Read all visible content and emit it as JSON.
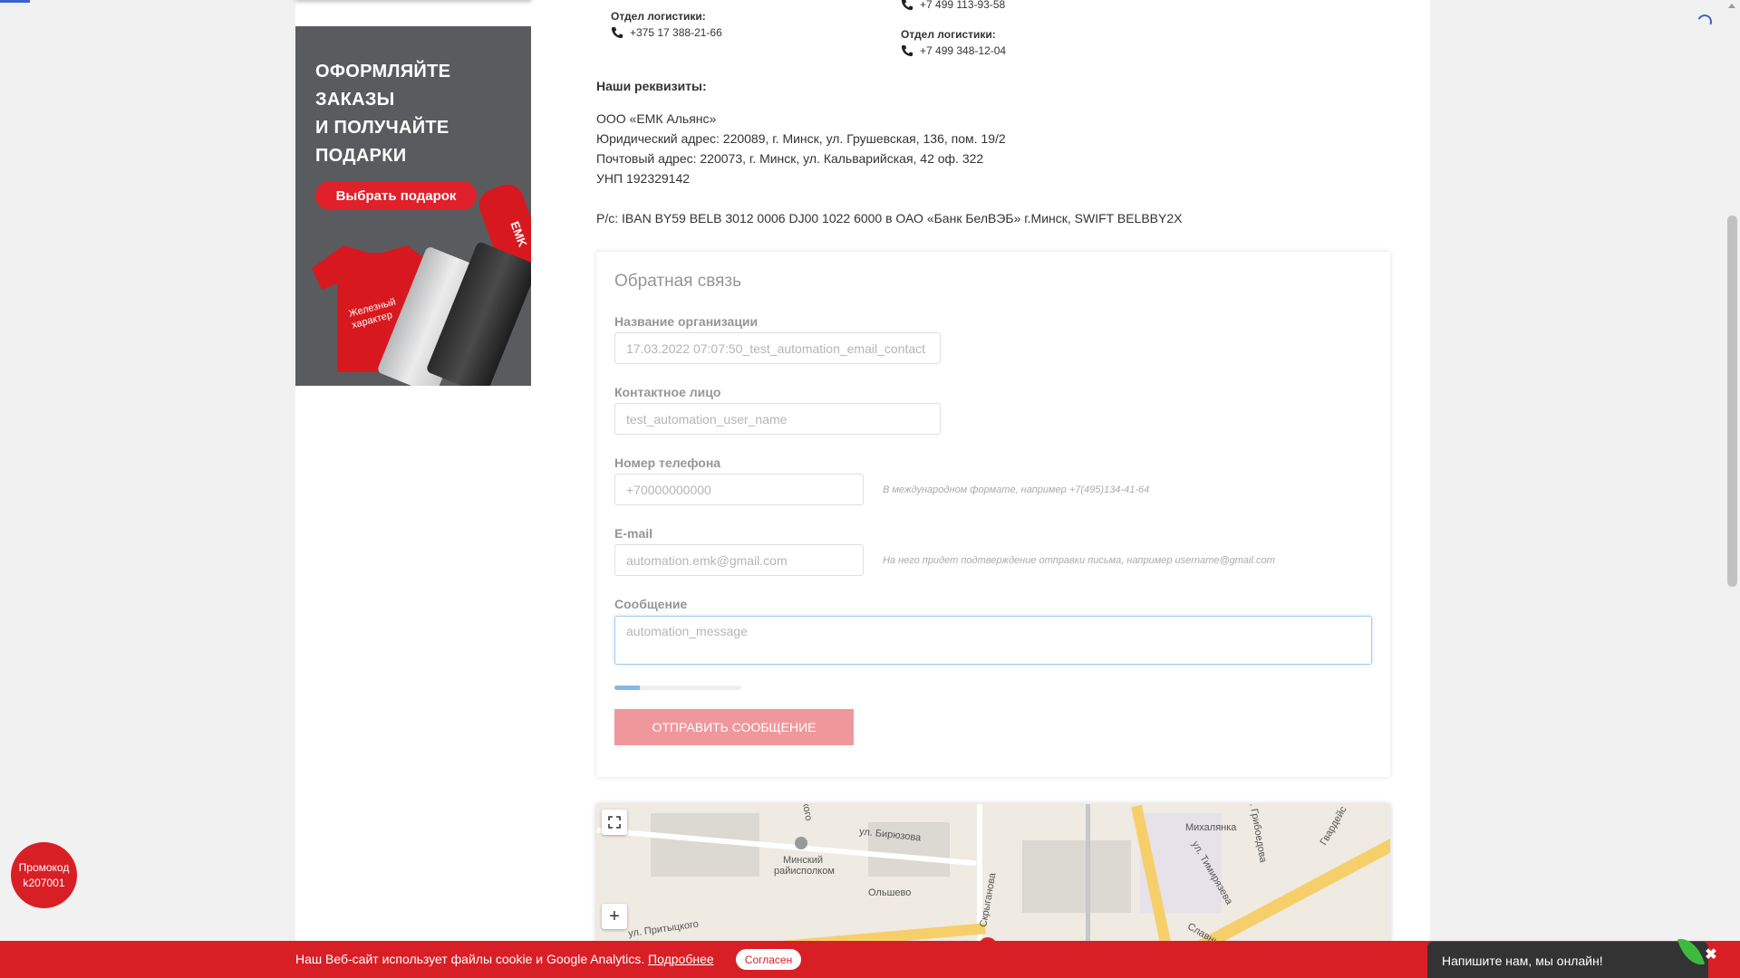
{
  "banner": {
    "lines": [
      "ОФОРМЛЯЙТЕ",
      "ЗАКАЗЫ",
      "И ПОЛУЧАЙТЕ",
      "ПОДАРКИ"
    ],
    "button": "Выбрать подарок",
    "shirt_line1": "Железный",
    "shirt_line2": "характер",
    "bottle_text": "EMK"
  },
  "contacts": {
    "left_label": "Отдел логистики:",
    "left_phone": "+375 17 388-21-66",
    "right_top_phone": "+7 499 113-93-58",
    "right_label": "Отдел логистики:",
    "right_phone": "+7 499 348-12-04"
  },
  "requisites": {
    "heading": "Наши реквизиты:",
    "company": "ООО «ЕМК Альянс»",
    "legal_address": "Юридический адрес: 220089, г. Минск, ул. Грушевская, 136, пом. 19/2",
    "postal_address": "Почтовый адрес: 220073, г. Минск, ул. Кальварийская, 42 оф. 322",
    "unp": "УНП 192329142",
    "account": "Р/с: IBAN BY59 BELB 3012 0006 DJ00 1022 6000 в ОАО «Банк БелВЭБ» г.Минск, SWIFT BELBBY2X"
  },
  "form": {
    "title": "Обратная связь",
    "org_label": "Название организации",
    "org_value": "17.03.2022 07:07:50_test_automation_email_contact",
    "contact_label": "Контактное лицо",
    "contact_value": "test_automation_user_name",
    "phone_label": "Номер телефона",
    "phone_value": "+70000000000",
    "phone_hint": "В международном формате, например +7(495)134-41-64",
    "email_label": "E-mail",
    "email_value": "automation.emk@gmail.com",
    "email_hint": "На него придет подтверждение отправки письма, например username@gmail.com",
    "message_label": "Сообщение",
    "message_value": "automation_message",
    "progress_fraction": 0.2,
    "submit": "Отправить сообщение"
  },
  "map": {
    "labels": {
      "ul_biryuzova": "ул. Бирюзова",
      "minsk_ispolkom_1": "Минский",
      "minsk_ispolkom_2": "райисполком",
      "olshevo": "Ольшево",
      "skryganova": "Скрыганова",
      "mikhalyanka": "Михалянка",
      "ul_gribo": "ул. Грибоедова",
      "ul_timiryazeva": "ул. Тимирязева",
      "ul_prititskogo": "ул. Притыцкого",
      "slavny": "Славный",
      "kogo": "кого",
      "gvardeyskaya": "Гвардейс"
    },
    "zoom_in": "+",
    "fullscreen_icon": "expand-icon"
  },
  "cookie": {
    "text": "Наш Веб-сайт использует файлы cookie и Google Analytics.",
    "link": "Подробнее",
    "button": "Согласен"
  },
  "chat": {
    "text": "Напишите нам, мы онлайн!",
    "close": "✖"
  },
  "promo": {
    "line1": "Промокод",
    "line2": "k207001"
  },
  "colors": {
    "brand_red": "#d91f26",
    "accent_blue": "#3a62d0"
  }
}
